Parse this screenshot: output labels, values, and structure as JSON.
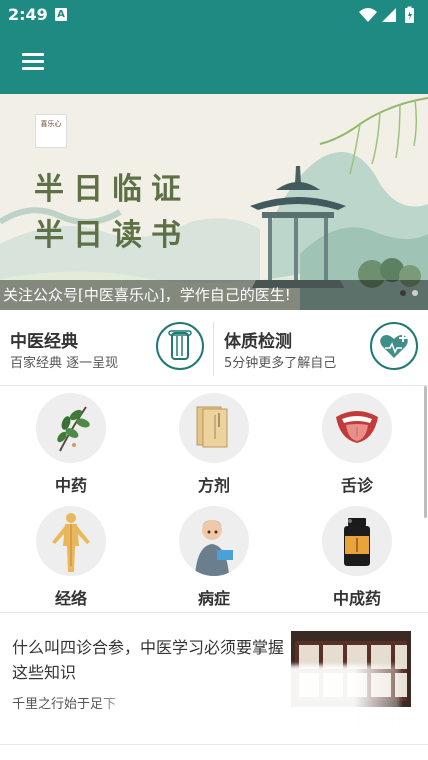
{
  "status_bar": {
    "time": "2:49",
    "notification_icon": "a-icon",
    "icons": [
      "wifi-icon",
      "signal-icon",
      "battery-icon"
    ]
  },
  "app_bar": {
    "menu_icon": "hamburger-menu-icon",
    "color": "#1f8a82"
  },
  "banner": {
    "line1": "半日临证",
    "line2": "半日读书",
    "caption": "关注公众号[中医喜乐心]，学作自己的医生!",
    "slides": 2,
    "active_slide": 1
  },
  "features": [
    {
      "title": "中医经典",
      "subtitle": "百家经典 逐一呈现",
      "icon": "book-scroll-icon"
    },
    {
      "title": "体质检测",
      "subtitle": "5分钟更多了解自己",
      "icon": "heart-plus-icon"
    }
  ],
  "categories": [
    {
      "label": "中药",
      "icon": "herb-branch-icon"
    },
    {
      "label": "方剂",
      "icon": "prescription-paper-icon"
    },
    {
      "label": "舌诊",
      "icon": "tongue-icon"
    },
    {
      "label": "经络",
      "icon": "meridian-body-icon"
    },
    {
      "label": "病症",
      "icon": "sick-person-icon"
    },
    {
      "label": "中成药",
      "icon": "medicine-bottle-icon"
    }
  ],
  "article": {
    "title": "什么叫四诊合参，中医学习必须要掌握这些知识",
    "description": "千里之行始于足下",
    "thumbnail": "cabinet-image"
  },
  "colors": {
    "primary": "#1f8a82",
    "icon_stroke": "#1f7a73",
    "banner_text": "#5e7046"
  }
}
